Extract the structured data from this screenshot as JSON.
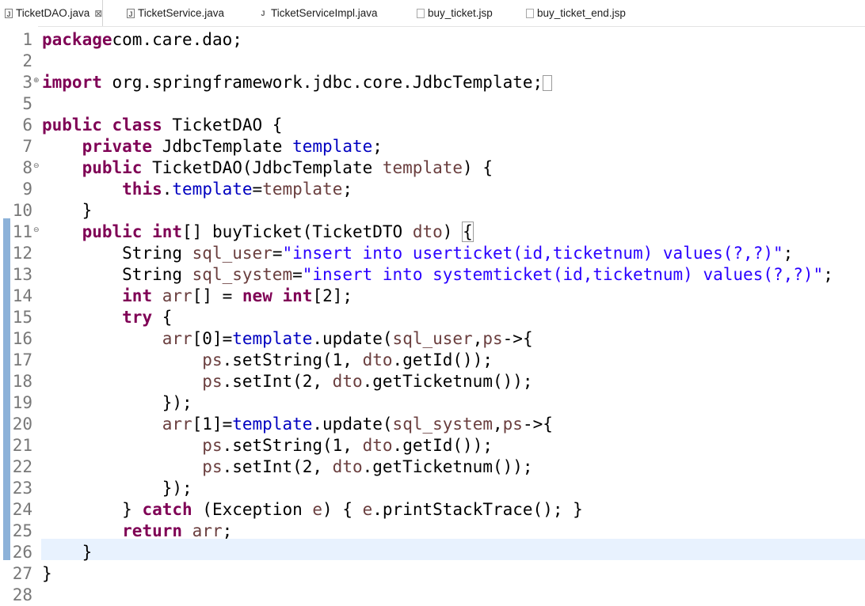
{
  "tabs": [
    {
      "label": "TicketDAO.java",
      "active": true,
      "icon": "java-file-icon"
    },
    {
      "label": "TicketService.java",
      "active": false,
      "icon": "java-interface-icon"
    },
    {
      "label": "TicketServiceImpl.java",
      "active": false,
      "icon": "java-class-icon"
    },
    {
      "label": "buy_ticket.jsp",
      "active": false,
      "icon": "jsp-file-icon"
    },
    {
      "label": "buy_ticket_end.jsp",
      "active": false,
      "icon": "jsp-file-icon"
    }
  ],
  "close_glyph": "⊠",
  "lines": [
    {
      "n": "1",
      "tokens": [
        [
          "kw",
          "package"
        ],
        [
          "",
          "com.care.dao;"
        ]
      ]
    },
    {
      "n": "2",
      "tokens": []
    },
    {
      "n": "3",
      "fold": "⊕",
      "tokens": [
        [
          "kw",
          "import"
        ],
        [
          "",
          " org.springframework.jdbc.core.JdbcTemplate;"
        ],
        [
          "box",
          ""
        ]
      ]
    },
    {
      "n": "5",
      "tokens": []
    },
    {
      "n": "6",
      "tokens": [
        [
          "kw",
          "public"
        ],
        [
          "",
          " "
        ],
        [
          "kw",
          "class"
        ],
        [
          "",
          " TicketDAO {"
        ]
      ]
    },
    {
      "n": "7",
      "tokens": [
        [
          "",
          "    "
        ],
        [
          "kw",
          "private"
        ],
        [
          "",
          " JdbcTemplate "
        ],
        [
          "fld",
          "template"
        ],
        [
          "",
          ";"
        ]
      ]
    },
    {
      "n": "8",
      "fold": "⊖",
      "tokens": [
        [
          "",
          "    "
        ],
        [
          "kw",
          "public"
        ],
        [
          "",
          " TicketDAO(JdbcTemplate "
        ],
        [
          "var",
          "template"
        ],
        [
          "",
          ") {"
        ]
      ]
    },
    {
      "n": "9",
      "tokens": [
        [
          "",
          "        "
        ],
        [
          "kw",
          "this"
        ],
        [
          "",
          "."
        ],
        [
          "fld",
          "template"
        ],
        [
          "",
          "="
        ],
        [
          "var",
          "template"
        ],
        [
          "",
          ";"
        ]
      ]
    },
    {
      "n": "10",
      "tokens": [
        [
          "",
          "    }"
        ]
      ]
    },
    {
      "n": "11",
      "fold": "⊖",
      "tokens": [
        [
          "",
          "    "
        ],
        [
          "kw",
          "public"
        ],
        [
          "",
          " "
        ],
        [
          "kw",
          "int"
        ],
        [
          "",
          "[] buyTicket(TicketDTO "
        ],
        [
          "var",
          "dto"
        ],
        [
          "",
          ") "
        ],
        [
          "bracebox",
          "{"
        ]
      ]
    },
    {
      "n": "12",
      "tokens": [
        [
          "",
          "        String "
        ],
        [
          "var",
          "sql_user"
        ],
        [
          "",
          "="
        ],
        [
          "str",
          "\"insert into userticket(id,ticketnum) values(?,?)\""
        ],
        [
          "",
          ";"
        ]
      ]
    },
    {
      "n": "13",
      "tokens": [
        [
          "",
          "        String "
        ],
        [
          "var",
          "sql_system"
        ],
        [
          "",
          "="
        ],
        [
          "str",
          "\"insert into systemticket(id,ticketnum) values(?,?)\""
        ],
        [
          "",
          ";"
        ]
      ]
    },
    {
      "n": "14",
      "tokens": [
        [
          "",
          "        "
        ],
        [
          "kw",
          "int"
        ],
        [
          "",
          " "
        ],
        [
          "var",
          "arr"
        ],
        [
          "",
          "[] = "
        ],
        [
          "kw",
          "new"
        ],
        [
          "",
          " "
        ],
        [
          "kw",
          "int"
        ],
        [
          "",
          "[2];"
        ]
      ]
    },
    {
      "n": "15",
      "tokens": [
        [
          "",
          "        "
        ],
        [
          "kw",
          "try"
        ],
        [
          "",
          " {"
        ]
      ]
    },
    {
      "n": "16",
      "tokens": [
        [
          "",
          "            "
        ],
        [
          "var",
          "arr"
        ],
        [
          "",
          "[0]="
        ],
        [
          "fld",
          "template"
        ],
        [
          "",
          ".update("
        ],
        [
          "var",
          "sql_user"
        ],
        [
          "",
          ","
        ],
        [
          "var",
          "ps"
        ],
        [
          "",
          "->{"
        ]
      ]
    },
    {
      "n": "17",
      "tokens": [
        [
          "",
          "                "
        ],
        [
          "var",
          "ps"
        ],
        [
          "",
          ".setString(1, "
        ],
        [
          "var",
          "dto"
        ],
        [
          "",
          ".getId());"
        ]
      ]
    },
    {
      "n": "18",
      "tokens": [
        [
          "",
          "                "
        ],
        [
          "var",
          "ps"
        ],
        [
          "",
          ".setInt(2, "
        ],
        [
          "var",
          "dto"
        ],
        [
          "",
          ".getTicketnum());"
        ]
      ]
    },
    {
      "n": "19",
      "tokens": [
        [
          "",
          "            });"
        ]
      ]
    },
    {
      "n": "20",
      "tokens": [
        [
          "",
          "            "
        ],
        [
          "var",
          "arr"
        ],
        [
          "",
          "[1]="
        ],
        [
          "fld",
          "template"
        ],
        [
          "",
          ".update("
        ],
        [
          "var",
          "sql_system"
        ],
        [
          "",
          ","
        ],
        [
          "var",
          "ps"
        ],
        [
          "",
          "->{"
        ]
      ]
    },
    {
      "n": "21",
      "tokens": [
        [
          "",
          "                "
        ],
        [
          "var",
          "ps"
        ],
        [
          "",
          ".setString(1, "
        ],
        [
          "var",
          "dto"
        ],
        [
          "",
          ".getId());"
        ]
      ]
    },
    {
      "n": "22",
      "tokens": [
        [
          "",
          "                "
        ],
        [
          "var",
          "ps"
        ],
        [
          "",
          ".setInt(2, "
        ],
        [
          "var",
          "dto"
        ],
        [
          "",
          ".getTicketnum());"
        ]
      ]
    },
    {
      "n": "23",
      "tokens": [
        [
          "",
          "            });"
        ]
      ]
    },
    {
      "n": "24",
      "tokens": [
        [
          "",
          "        } "
        ],
        [
          "kw",
          "catch"
        ],
        [
          "",
          " (Exception "
        ],
        [
          "var",
          "e"
        ],
        [
          "",
          ") { "
        ],
        [
          "var",
          "e"
        ],
        [
          "",
          ".printStackTrace(); }"
        ]
      ]
    },
    {
      "n": "25",
      "tokens": [
        [
          "",
          "        "
        ],
        [
          "kw",
          "return"
        ],
        [
          "",
          " "
        ],
        [
          "var",
          "arr"
        ],
        [
          "",
          ";"
        ]
      ]
    },
    {
      "n": "26",
      "current": true,
      "tokens": [
        [
          "",
          "    }"
        ]
      ]
    },
    {
      "n": "27",
      "tokens": [
        [
          "",
          "}"
        ]
      ]
    },
    {
      "n": "28",
      "tokens": []
    }
  ],
  "colors": {
    "keyword": "#7f0055",
    "field": "#0000c0",
    "string": "#2a00ff",
    "local_variable": "#6a3e3e",
    "current_line": "#e8f2fe",
    "change_bar": "#8db2d9"
  }
}
